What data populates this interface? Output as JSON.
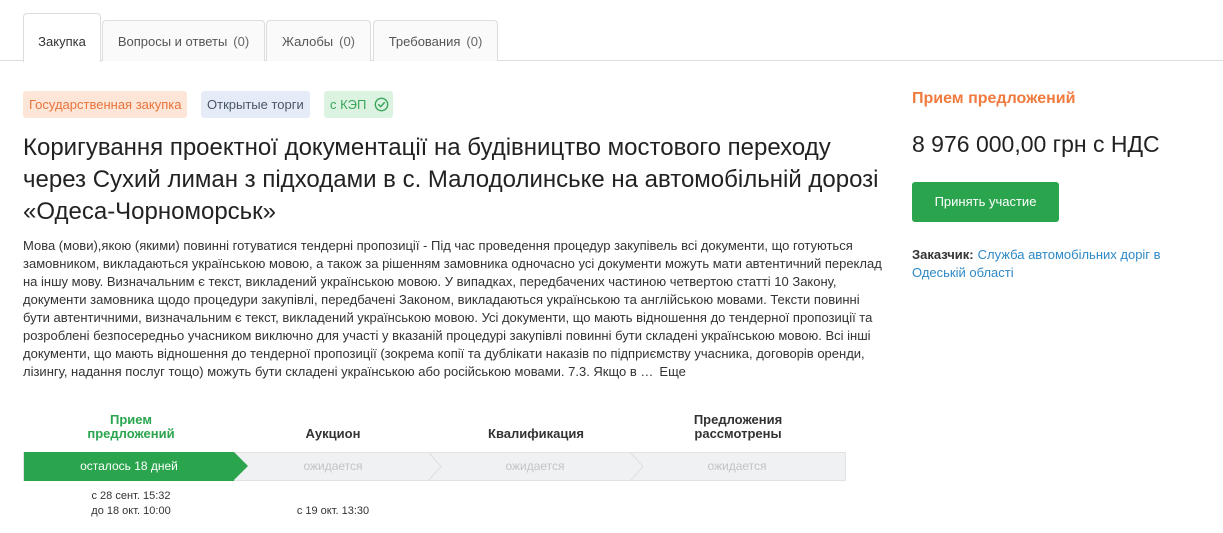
{
  "tabs": [
    {
      "label": "Закупка"
    },
    {
      "label": "Вопросы и ответы",
      "count": "(0)"
    },
    {
      "label": "Жалобы",
      "count": "(0)"
    },
    {
      "label": "Требования",
      "count": "(0)"
    }
  ],
  "badges": {
    "gov": "Государственная закупка",
    "open": "Открытые торги",
    "kep": "с КЭП"
  },
  "title": "Коригування проектної документації на будівництво мостового переходу через Сухий лиман з підходами в с. Малодолинське на автомобільній дорозі «Одеса-Чорноморськ»",
  "description": "Мова (мови),якою (якими) повинні готуватися тендерні пропозиції - Під час проведення процедур закупівель всі документи, що готуються замовником, викладаються українською мовою, а також за рішенням замовника одночасно усі документи можуть мати автентичний переклад на іншу мову. Визначальним є текст, викладений українською мовою. У випадках, передбачених частиною четвертою статті 10 Закону, документи замовника щодо процедури закупівлі, передбачені Законом, викладаються українською та англійською мовами. Тексти повинні бути автентичними, визначальним є текст, викладений українською мовою. Усі документи, що мають відношення до тендерної пропозиції та розроблені безпосередньо учасником виключно для участі у вказаній процедурі закупівлі повинні бути складені українською мовою. Всі інші документи, що мають відношення до тендерної пропозиції (зокрема копії та дублікати наказів по підприємству учасника, договорів оренди, лізингу, надання послуг тощо) можуть бути складені українською або російською мовами. 7.3. Якщо в …",
  "more_label": "Еще",
  "timeline": {
    "stages": [
      {
        "label_line1": "Прием",
        "label_line2": "предложений",
        "status": "осталось 18 дней",
        "date1": "с 28 сент. 15:32",
        "date2": "до 18 окт. 10:00"
      },
      {
        "label_line1": "",
        "label_line2": "Аукцион",
        "status": "ожидается",
        "date1": "",
        "date2": "с 19 окт. 13:30"
      },
      {
        "label_line1": "",
        "label_line2": "Квалификация",
        "status": "ожидается"
      },
      {
        "label_line1": "Предложения",
        "label_line2": "рассмотрены",
        "status": "ожидается"
      }
    ]
  },
  "sidebar": {
    "status": "Прием предложений",
    "price": "8 976 000,00 грн с НДС",
    "participate_button": "Принять участие",
    "customer_label": "Заказчик:",
    "customer_name": "Служба автомобільних доріг в Одеській області"
  },
  "colors": {
    "accent_green": "#2aa54e",
    "status_orange": "#f07b3f",
    "link_blue": "#2e89c6"
  }
}
